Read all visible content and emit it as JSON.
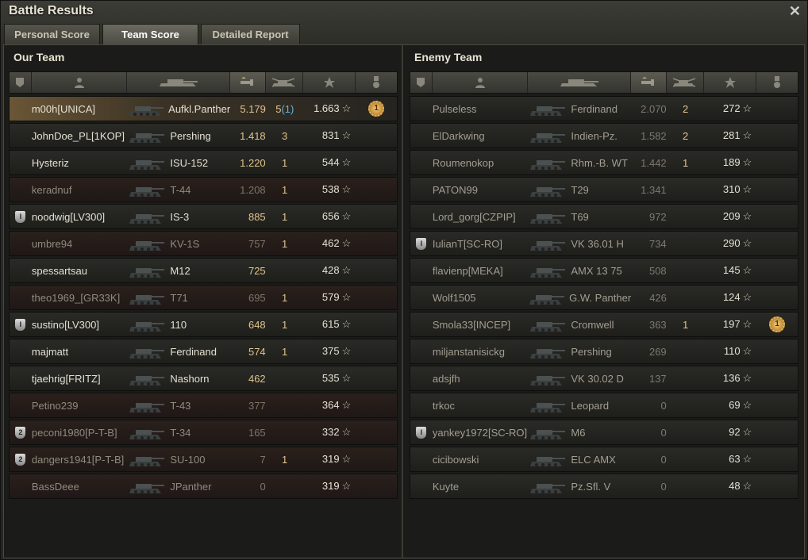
{
  "window": {
    "title": "Battle Results",
    "close": "✕"
  },
  "tabs": [
    {
      "label": "Personal Score",
      "active": false
    },
    {
      "label": "Team Score",
      "active": true
    },
    {
      "label": "Detailed Report",
      "active": false
    }
  ],
  "our_team": {
    "title": "Our Team",
    "rows": [
      {
        "badge": "",
        "name": "m00h[UNICA]",
        "tank": "Aufkl.Panther",
        "dmg": "5.179",
        "kills": "5",
        "kills_extra": "(1)",
        "xp": "1.663",
        "medal": "1",
        "me": true,
        "alive": true
      },
      {
        "badge": "",
        "name": "JohnDoe_PL[1KOP]",
        "tank": "Pershing",
        "dmg": "1.418",
        "kills": "3",
        "kills_extra": "",
        "xp": "831",
        "medal": "",
        "alive": true
      },
      {
        "badge": "",
        "name": "Hysteriz",
        "tank": "ISU-152",
        "dmg": "1.220",
        "kills": "1",
        "kills_extra": "",
        "xp": "544",
        "medal": "",
        "alive": true
      },
      {
        "badge": "",
        "name": "keradnuf",
        "tank": "T-44",
        "dmg": "1.208",
        "kills": "1",
        "kills_extra": "",
        "xp": "538",
        "medal": "",
        "alive": false
      },
      {
        "badge": "I",
        "name": "noodwig[LV300]",
        "tank": "IS-3",
        "dmg": "885",
        "kills": "1",
        "kills_extra": "",
        "xp": "656",
        "medal": "",
        "alive": true
      },
      {
        "badge": "",
        "name": "umbre94",
        "tank": "KV-1S",
        "dmg": "757",
        "kills": "1",
        "kills_extra": "",
        "xp": "462",
        "medal": "",
        "alive": false
      },
      {
        "badge": "",
        "name": "spessartsau",
        "tank": "M12",
        "dmg": "725",
        "kills": "",
        "kills_extra": "",
        "xp": "428",
        "medal": "",
        "alive": true
      },
      {
        "badge": "",
        "name": "theo1969_[GR33K]",
        "tank": "T71",
        "dmg": "695",
        "kills": "1",
        "kills_extra": "",
        "xp": "579",
        "medal": "",
        "alive": false
      },
      {
        "badge": "I",
        "name": "sustino[LV300]",
        "tank": "110",
        "dmg": "648",
        "kills": "1",
        "kills_extra": "",
        "xp": "615",
        "medal": "",
        "alive": true
      },
      {
        "badge": "",
        "name": "majmatt",
        "tank": "Ferdinand",
        "dmg": "574",
        "kills": "1",
        "kills_extra": "",
        "xp": "375",
        "medal": "",
        "alive": true
      },
      {
        "badge": "",
        "name": "tjaehrig[FRITZ]",
        "tank": "Nashorn",
        "dmg": "462",
        "kills": "",
        "kills_extra": "",
        "xp": "535",
        "medal": "",
        "alive": true
      },
      {
        "badge": "",
        "name": "Petino239",
        "tank": "T-43",
        "dmg": "377",
        "kills": "",
        "kills_extra": "",
        "xp": "364",
        "medal": "",
        "alive": false
      },
      {
        "badge": "2",
        "name": "peconi1980[P-T-B]",
        "tank": "T-34",
        "dmg": "165",
        "kills": "",
        "kills_extra": "",
        "xp": "332",
        "medal": "",
        "alive": false
      },
      {
        "badge": "2",
        "name": "dangers1941[P-T-B]",
        "tank": "SU-100",
        "dmg": "7",
        "kills": "1",
        "kills_extra": "",
        "xp": "319",
        "medal": "",
        "alive": false
      },
      {
        "badge": "",
        "name": "BassDeee",
        "tank": "JPanther",
        "dmg": "0",
        "kills": "",
        "kills_extra": "",
        "xp": "319",
        "medal": "",
        "alive": false
      }
    ]
  },
  "enemy_team": {
    "title": "Enemy Team",
    "rows": [
      {
        "badge": "",
        "name": "Pulseless",
        "tank": "Ferdinand",
        "dmg": "2.070",
        "kills": "2",
        "xp": "272",
        "medal": ""
      },
      {
        "badge": "",
        "name": "ElDarkwing",
        "tank": "Indien-Pz.",
        "dmg": "1.582",
        "kills": "2",
        "xp": "281",
        "medal": ""
      },
      {
        "badge": "",
        "name": "Roumenokop",
        "tank": "Rhm.-B. WT",
        "dmg": "1.442",
        "kills": "1",
        "xp": "189",
        "medal": ""
      },
      {
        "badge": "",
        "name": "PATON99",
        "tank": "T29",
        "dmg": "1.341",
        "kills": "",
        "xp": "310",
        "medal": ""
      },
      {
        "badge": "",
        "name": "Lord_gorg[CZPIP]",
        "tank": "T69",
        "dmg": "972",
        "kills": "",
        "xp": "209",
        "medal": ""
      },
      {
        "badge": "I",
        "name": "IulianT[SC-RO]",
        "tank": "VK 36.01 H",
        "dmg": "734",
        "kills": "",
        "xp": "290",
        "medal": ""
      },
      {
        "badge": "",
        "name": "flavienp[MEKA]",
        "tank": "AMX 13 75",
        "dmg": "508",
        "kills": "",
        "xp": "145",
        "medal": ""
      },
      {
        "badge": "",
        "name": "Wolf1505",
        "tank": "G.W. Panther",
        "dmg": "426",
        "kills": "",
        "xp": "124",
        "medal": ""
      },
      {
        "badge": "",
        "name": "Smola33[INCEP]",
        "tank": "Cromwell",
        "dmg": "363",
        "kills": "1",
        "xp": "197",
        "medal": "1"
      },
      {
        "badge": "",
        "name": "miljanstanisickg",
        "tank": "Pershing",
        "dmg": "269",
        "kills": "",
        "xp": "110",
        "medal": ""
      },
      {
        "badge": "",
        "name": "adsjfh",
        "tank": "VK 30.02 D",
        "dmg": "137",
        "kills": "",
        "xp": "136",
        "medal": ""
      },
      {
        "badge": "",
        "name": "trkoc",
        "tank": "Leopard",
        "dmg": "0",
        "kills": "",
        "xp": "69",
        "medal": ""
      },
      {
        "badge": "I",
        "name": "yankey1972[SC-RO]",
        "tank": "M6",
        "dmg": "0",
        "kills": "",
        "xp": "92",
        "medal": ""
      },
      {
        "badge": "",
        "name": "cicibowski",
        "tank": "ELC AMX",
        "dmg": "0",
        "kills": "",
        "xp": "63",
        "medal": ""
      },
      {
        "badge": "",
        "name": "Kuyte",
        "tank": "Pz.Sfl. V",
        "dmg": "0",
        "kills": "",
        "xp": "48",
        "medal": ""
      }
    ]
  },
  "icons": {
    "xp_star": "☆",
    "close": "close-icon"
  }
}
